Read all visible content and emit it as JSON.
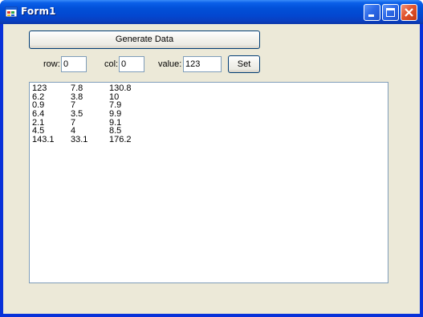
{
  "window": {
    "title": "Form1",
    "icon": "form-icon"
  },
  "toolbar": {
    "generate_label": "Generate Data",
    "set_label": "Set"
  },
  "inputs": {
    "row_label": "row:",
    "row_value": "0",
    "col_label": "col:",
    "col_value": "0",
    "value_label": "value:",
    "value_value": "123"
  },
  "output": {
    "rows": [
      [
        "123",
        "7.8",
        "130.8"
      ],
      [
        "6.2",
        "3.8",
        "10"
      ],
      [
        "0.9",
        "7",
        "7.9"
      ],
      [
        "6.4",
        "3.5",
        "9.9"
      ],
      [
        "2.1",
        "7",
        "9.1"
      ],
      [
        "4.5",
        "4",
        "8.5"
      ],
      [
        "143.1",
        "33.1",
        "176.2"
      ]
    ]
  },
  "colors": {
    "title_bar": "#0250d8",
    "client_background": "#ece9d8",
    "textbox_border": "#7f9db9",
    "button_border": "#003c74",
    "close_button": "#e2542e"
  }
}
